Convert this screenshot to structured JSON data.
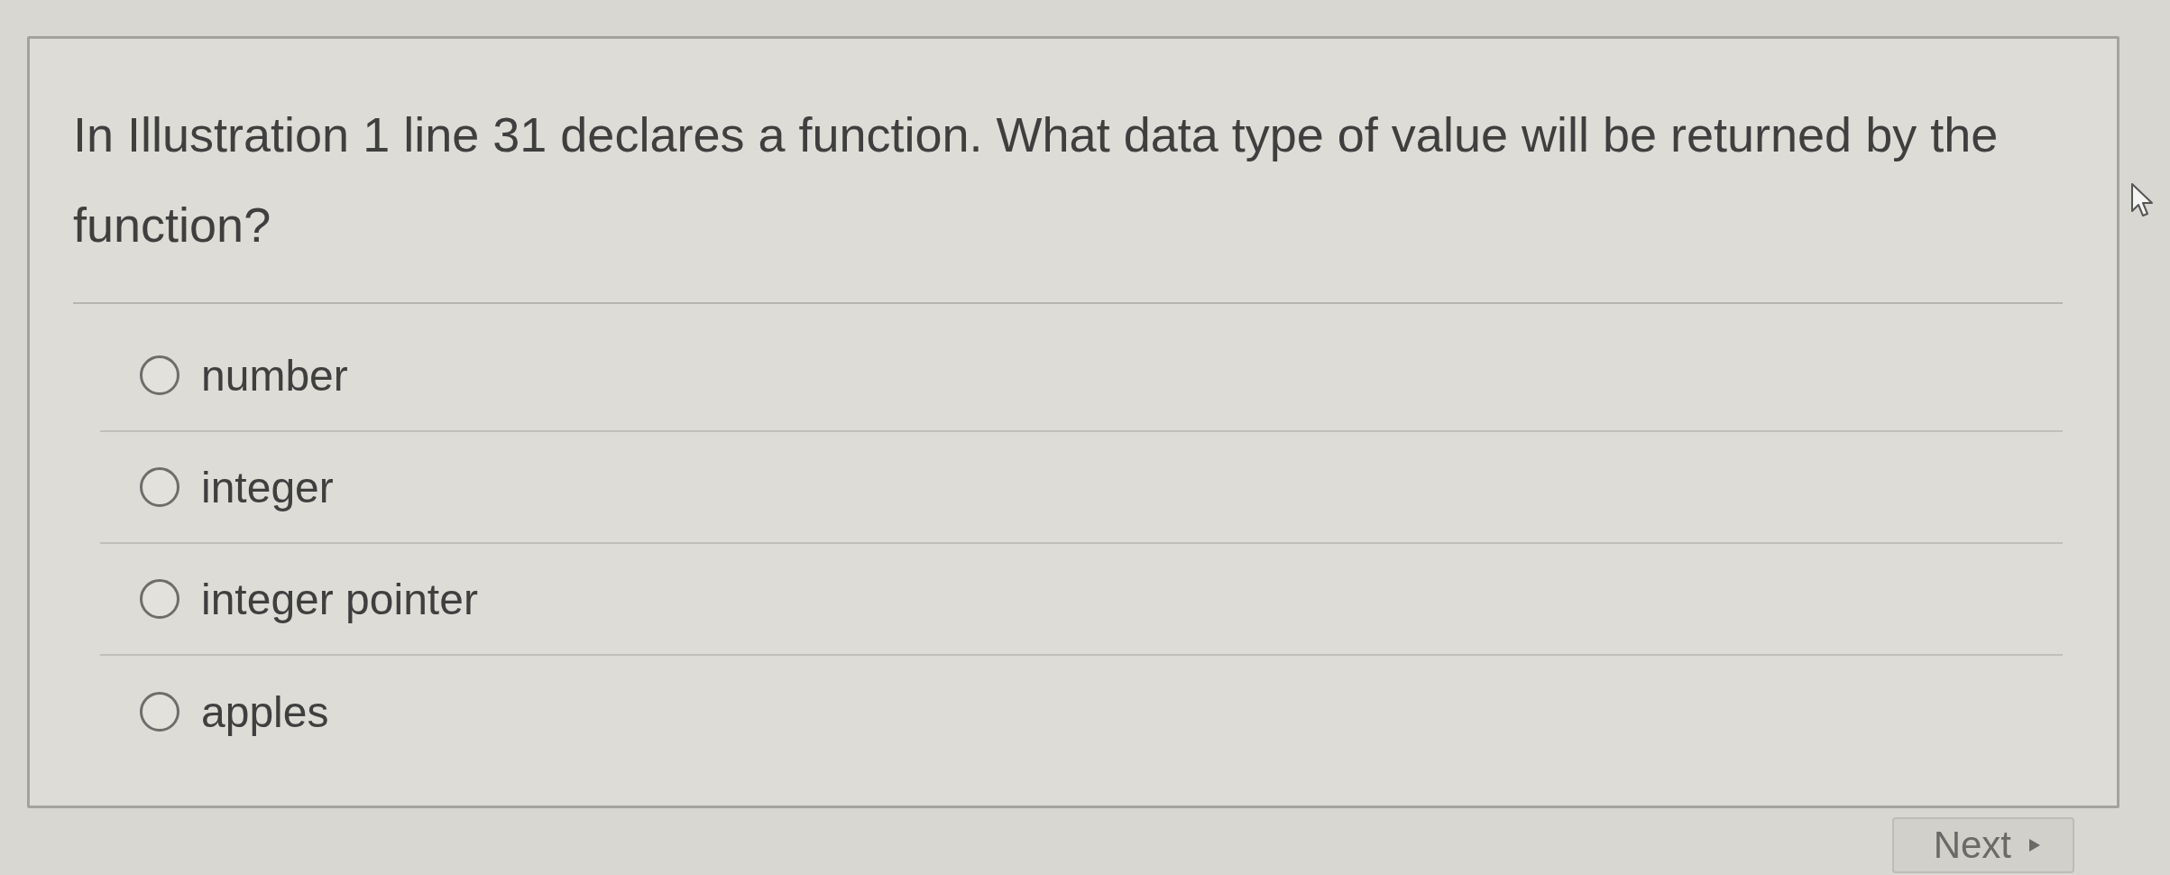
{
  "question": {
    "text": "In Illustration 1 line 31 declares a function. What data type of value will be returned by the function?"
  },
  "options": [
    {
      "label": "number",
      "selected": false
    },
    {
      "label": "integer",
      "selected": false
    },
    {
      "label": "integer pointer",
      "selected": false
    },
    {
      "label": "apples",
      "selected": false
    }
  ],
  "next_button": {
    "label": "Next"
  }
}
